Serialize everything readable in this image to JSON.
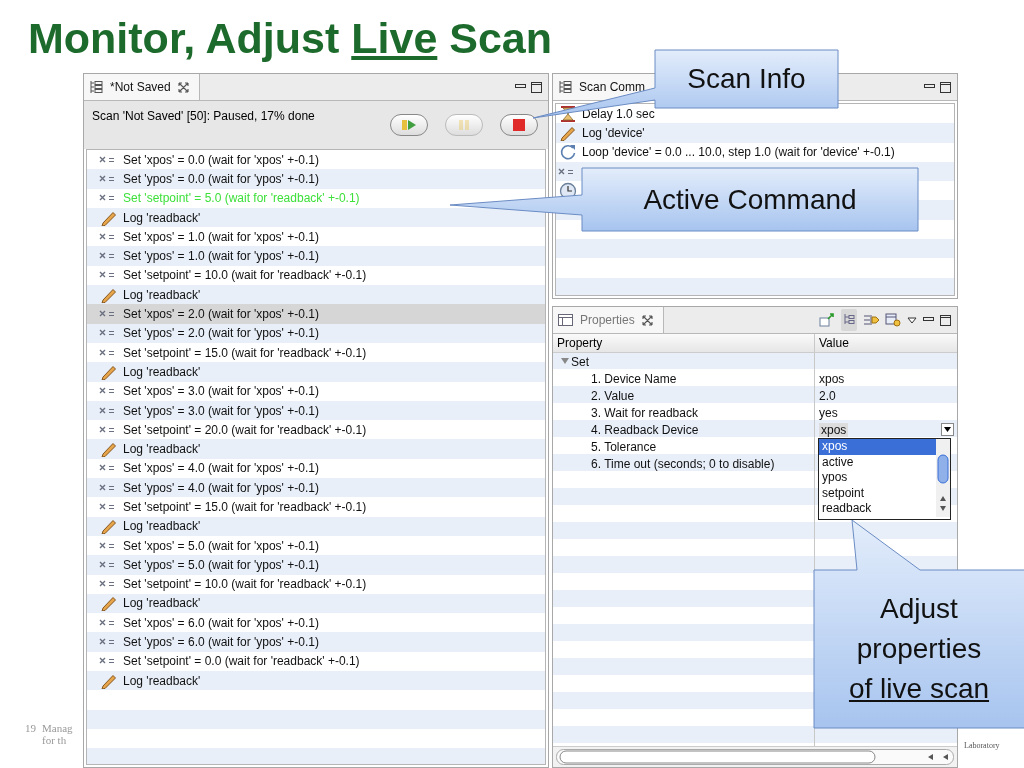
{
  "title": [
    {
      "text": "Monitor, Adjust ",
      "underline": false
    },
    {
      "text": "Live",
      "underline": true
    },
    {
      "text": " Scan",
      "underline": false
    }
  ],
  "editor": {
    "tab": {
      "label": "*Not Saved"
    },
    "status": "Scan 'Not Saved' [50]: Paused, 17% done",
    "buttons": [
      {
        "kind": "resume",
        "disabled": false
      },
      {
        "kind": "pause",
        "disabled": true
      },
      {
        "kind": "abort",
        "disabled": false
      }
    ],
    "rows": [
      {
        "kind": "set",
        "text": "Set 'xpos' = 0.0 (wait for 'xpos' +-0.1)",
        "active": false,
        "selected": false
      },
      {
        "kind": "set",
        "text": "Set 'ypos' = 0.0 (wait for 'ypos' +-0.1)",
        "active": false,
        "selected": false
      },
      {
        "kind": "set",
        "text": "Set 'setpoint' = 5.0 (wait for 'readback' +-0.1)",
        "active": true,
        "selected": false
      },
      {
        "kind": "log",
        "text": "Log 'readback'",
        "active": false,
        "selected": false
      },
      {
        "kind": "set",
        "text": "Set 'xpos' = 1.0 (wait for 'xpos' +-0.1)",
        "active": false,
        "selected": false
      },
      {
        "kind": "set",
        "text": "Set 'ypos' = 1.0 (wait for 'ypos' +-0.1)",
        "active": false,
        "selected": false
      },
      {
        "kind": "set",
        "text": "Set 'setpoint' = 10.0 (wait for 'readback' +-0.1)",
        "active": false,
        "selected": false
      },
      {
        "kind": "log",
        "text": "Log 'readback'",
        "active": false,
        "selected": false
      },
      {
        "kind": "set",
        "text": "Set 'xpos' = 2.0 (wait for 'xpos' +-0.1)",
        "active": false,
        "selected": true
      },
      {
        "kind": "set",
        "text": "Set 'ypos' = 2.0 (wait for 'ypos' +-0.1)",
        "active": false,
        "selected": false
      },
      {
        "kind": "set",
        "text": "Set 'setpoint' = 15.0 (wait for 'readback' +-0.1)",
        "active": false,
        "selected": false
      },
      {
        "kind": "log",
        "text": "Log 'readback'",
        "active": false,
        "selected": false
      },
      {
        "kind": "set",
        "text": "Set 'xpos' = 3.0 (wait for 'xpos' +-0.1)",
        "active": false,
        "selected": false
      },
      {
        "kind": "set",
        "text": "Set 'ypos' = 3.0 (wait for 'ypos' +-0.1)",
        "active": false,
        "selected": false
      },
      {
        "kind": "set",
        "text": "Set 'setpoint' = 20.0 (wait for 'readback' +-0.1)",
        "active": false,
        "selected": false
      },
      {
        "kind": "log",
        "text": "Log 'readback'",
        "active": false,
        "selected": false
      },
      {
        "kind": "set",
        "text": "Set 'xpos' = 4.0 (wait for 'xpos' +-0.1)",
        "active": false,
        "selected": false
      },
      {
        "kind": "set",
        "text": "Set 'ypos' = 4.0 (wait for 'ypos' +-0.1)",
        "active": false,
        "selected": false
      },
      {
        "kind": "set",
        "text": "Set 'setpoint' = 15.0 (wait for 'readback' +-0.1)",
        "active": false,
        "selected": false
      },
      {
        "kind": "log",
        "text": "Log 'readback'",
        "active": false,
        "selected": false
      },
      {
        "kind": "set",
        "text": "Set 'xpos' = 5.0 (wait for 'xpos' +-0.1)",
        "active": false,
        "selected": false
      },
      {
        "kind": "set",
        "text": "Set 'ypos' = 5.0 (wait for 'ypos' +-0.1)",
        "active": false,
        "selected": false
      },
      {
        "kind": "set",
        "text": "Set 'setpoint' = 10.0 (wait for 'readback' +-0.1)",
        "active": false,
        "selected": false
      },
      {
        "kind": "log",
        "text": "Log 'readback'",
        "active": false,
        "selected": false
      },
      {
        "kind": "set",
        "text": "Set 'xpos' = 6.0 (wait for 'xpos' +-0.1)",
        "active": false,
        "selected": false
      },
      {
        "kind": "set",
        "text": "Set 'ypos' = 6.0 (wait for 'ypos' +-0.1)",
        "active": false,
        "selected": false
      },
      {
        "kind": "set",
        "text": "Set 'setpoint' = 0.0 (wait for 'readback' +-0.1)",
        "active": false,
        "selected": false
      },
      {
        "kind": "log",
        "text": "Log 'readback'",
        "active": false,
        "selected": false
      }
    ]
  },
  "commands": {
    "tab": {
      "label": "Scan Comm"
    },
    "rows": [
      {
        "kind": "delay",
        "text": "Delay 1.0 sec"
      },
      {
        "kind": "log",
        "text": "Log 'device'"
      },
      {
        "kind": "loop",
        "text": "Loop 'device' = 0.0 ... 10.0, step 1.0 (wait for 'device' +-0.1)"
      },
      {
        "kind": "set"
      },
      {
        "kind": "wait"
      }
    ]
  },
  "properties": {
    "tab": {
      "label": "Properties"
    },
    "columns": [
      "Property",
      "Value"
    ],
    "rows": [
      {
        "label": "Set",
        "expanded": true,
        "children": [
          {
            "label": "1. Device Name",
            "value": "xpos"
          },
          {
            "label": "2. Value",
            "value": "2.0"
          },
          {
            "label": "3. Wait for readback",
            "value": "yes"
          },
          {
            "label": "4. Readback Device",
            "value": "xpos",
            "dropdown": {
              "options": [
                {
                  "label": "xpos",
                  "selected": true
                },
                {
                  "label": "active",
                  "selected": false
                },
                {
                  "label": "ypos",
                  "selected": false
                },
                {
                  "label": "setpoint",
                  "selected": false
                },
                {
                  "label": "readback",
                  "selected": false
                }
              ]
            }
          },
          {
            "label": "5. Tolerance"
          },
          {
            "label": "6. Time out (seconds; 0 to disable)"
          }
        ]
      }
    ]
  },
  "callouts": [
    {
      "lines": [
        {
          "text": "Scan Info",
          "underline": false
        }
      ]
    },
    {
      "lines": [
        {
          "text": "Active Command",
          "underline": false
        }
      ]
    },
    {
      "lines": [
        {
          "text": "Adjust",
          "underline": false
        },
        {
          "text": "properties",
          "underline": false
        },
        {
          "text": "of live scan",
          "underline": true
        }
      ]
    }
  ],
  "footer": {
    "page": "19",
    "lines": [
      "Manag",
      "for th"
    ],
    "logo_text": "Laboratory"
  }
}
